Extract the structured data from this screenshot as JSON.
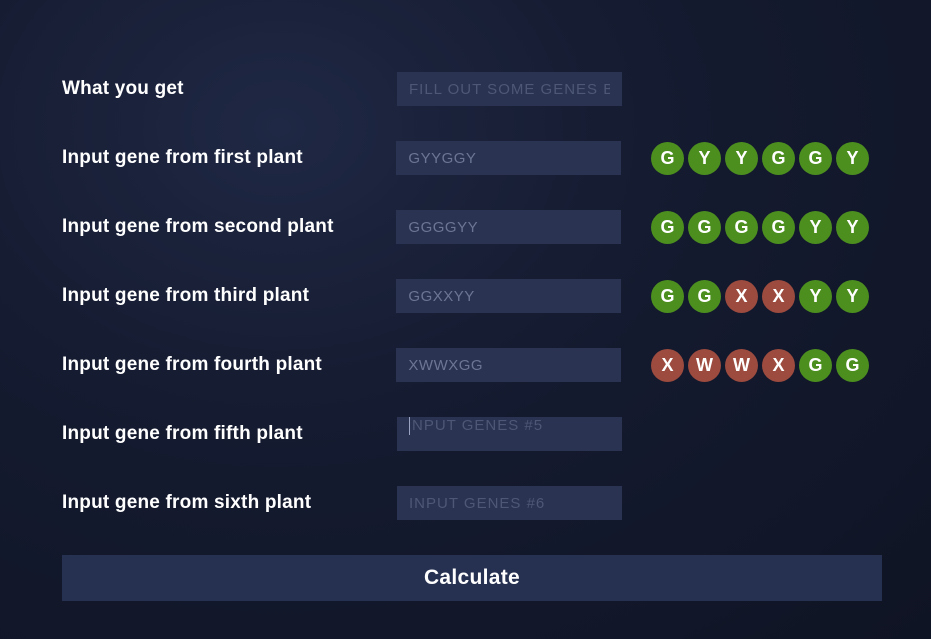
{
  "rows": [
    {
      "label": "What you get",
      "value": "",
      "placeholder": "FILL OUT SOME GENES B",
      "genes": []
    },
    {
      "label": "Input gene from first plant",
      "value": "GYYGGY",
      "placeholder": "",
      "genes": [
        "G",
        "Y",
        "Y",
        "G",
        "G",
        "Y"
      ]
    },
    {
      "label": "Input gene from second plant",
      "value": "GGGGYY",
      "placeholder": "",
      "genes": [
        "G",
        "G",
        "G",
        "G",
        "Y",
        "Y"
      ]
    },
    {
      "label": "Input gene from third plant",
      "value": "GGXXYY",
      "placeholder": "",
      "genes": [
        "G",
        "G",
        "X",
        "X",
        "Y",
        "Y"
      ]
    },
    {
      "label": "Input gene from fourth plant",
      "value": "XWWXGG",
      "placeholder": "",
      "genes": [
        "X",
        "W",
        "W",
        "X",
        "G",
        "G"
      ]
    },
    {
      "label": "Input gene from fifth plant",
      "value": "",
      "placeholder": "NPUT GENES #5",
      "genes": [],
      "focused": true
    },
    {
      "label": "Input gene from sixth plant",
      "value": "",
      "placeholder": "INPUT GENES #6",
      "genes": []
    }
  ],
  "button": "Calculate",
  "gene_colors": {
    "G": "#4c8f1f",
    "Y": "#4c8f1f",
    "H": "#4c8f1f",
    "X": "#9c4b3e",
    "W": "#9c4b3e"
  }
}
